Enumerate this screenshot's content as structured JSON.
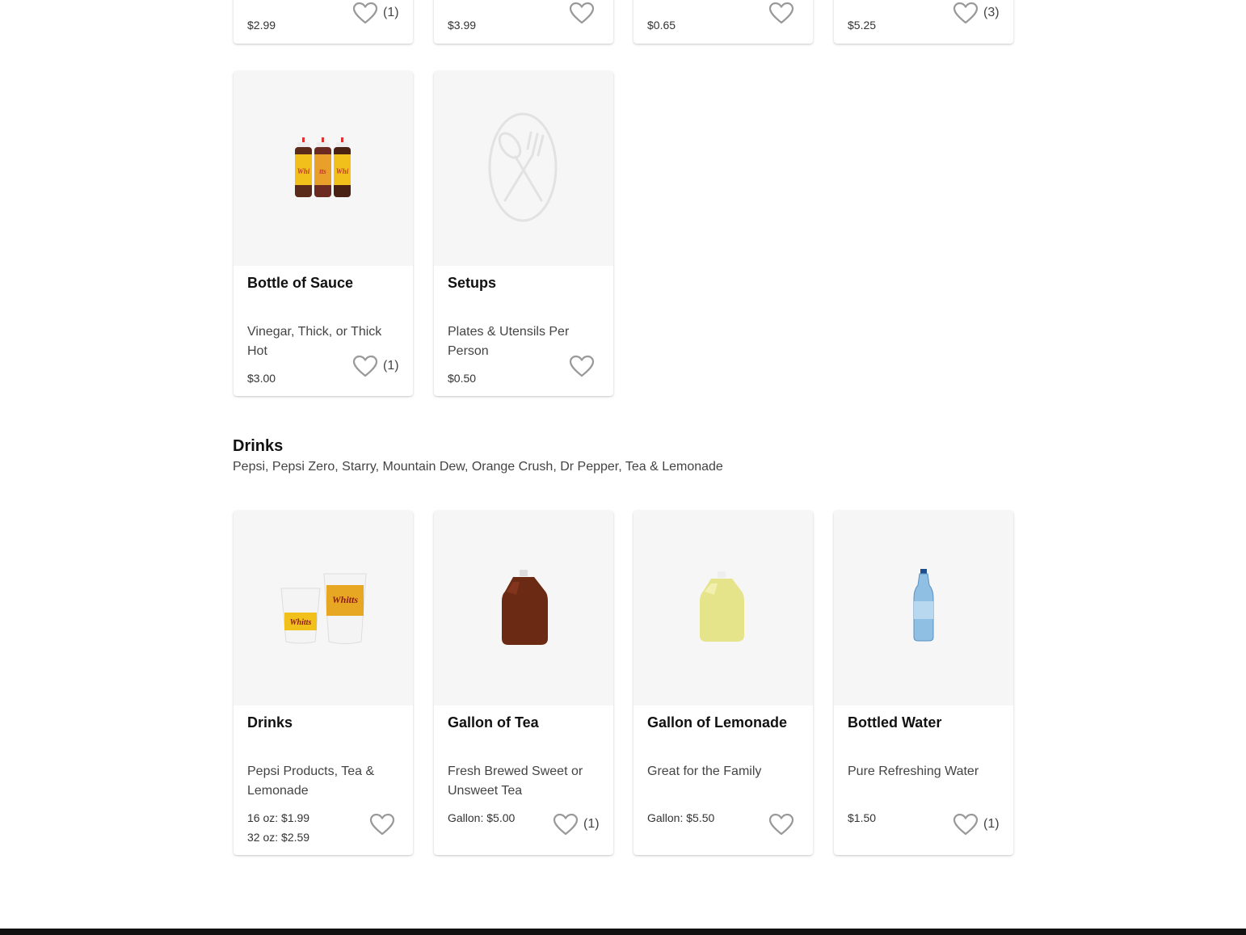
{
  "top_row": [
    {
      "price": "$2.99",
      "fav_count": "(1)"
    },
    {
      "price": "$3.99",
      "fav_count": ""
    },
    {
      "price": "$0.65",
      "fav_count": ""
    },
    {
      "price": "$5.25",
      "fav_count": "(3)"
    }
  ],
  "sides_row": [
    {
      "title": "Bottle of Sauce",
      "desc": "Vinegar, Thick, or Thick Hot",
      "price": "$3.00",
      "fav_count": "(1)",
      "image": "sauce-bottles-image"
    },
    {
      "title": "Setups",
      "desc": "Plates & Utensils Per Person",
      "price": "$0.50",
      "fav_count": "",
      "image": "plate-utensils-placeholder-icon"
    }
  ],
  "drinks_section": {
    "title": "Drinks",
    "desc": "Pepsi, Pepsi Zero, Starry, Mountain Dew, Orange Crush, Dr Pepper, Tea & Lemonade"
  },
  "drinks_row": [
    {
      "title": "Drinks",
      "desc": "Pepsi Products, Tea & Lemonade",
      "price_lines": [
        "16 oz: $1.99",
        "32 oz: $2.59"
      ],
      "fav_count": "",
      "image": "drink-cups-image"
    },
    {
      "title": "Gallon of Tea",
      "desc": "Fresh Brewed Sweet or Unsweet Tea",
      "price_lines": [
        "Gallon: $5.00"
      ],
      "fav_count": "(1)",
      "image": "tea-gallon-image"
    },
    {
      "title": "Gallon of Lemonade",
      "desc": "Great for the Family",
      "price_lines": [
        "Gallon: $5.50"
      ],
      "fav_count": "",
      "image": "lemonade-gallon-image"
    },
    {
      "title": "Bottled Water",
      "desc": "Pure Refreshing Water",
      "price_lines": [
        "$1.50"
      ],
      "fav_count": "(1)",
      "image": "water-bottle-image"
    }
  ],
  "colors": {
    "card_image_bg": "#f6f6f6",
    "heart_stroke": "#999999",
    "footer": "#111111"
  }
}
